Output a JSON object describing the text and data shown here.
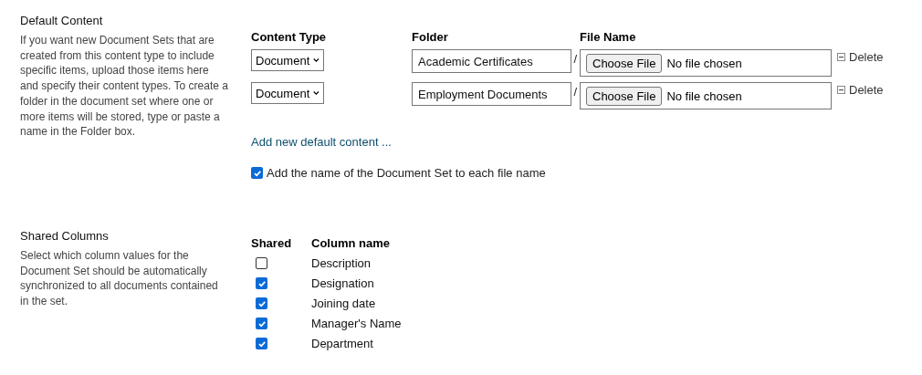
{
  "default_content": {
    "title": "Default Content",
    "description": "If you want new Document Sets that are created from this content type to include specific items, upload those items here and specify their content types. To create a folder in the document set where one or more items will be stored, type or paste a name in the Folder box.",
    "columns": [
      "Content Type",
      "Folder",
      "File Name"
    ],
    "rows": [
      {
        "content_type": "Document",
        "folder": "Academic Certificates",
        "separator": "/",
        "file_button": "Choose File",
        "file_status": "No file chosen",
        "delete": "Delete"
      },
      {
        "content_type": "Document",
        "folder": "Employment Documents",
        "separator": "/",
        "file_button": "Choose File",
        "file_status": "No file chosen",
        "delete": "Delete"
      }
    ],
    "add_link": "Add new default content ...",
    "add_name_option": {
      "label": "Add the name of the Document Set to each file name",
      "checked": true
    }
  },
  "shared_columns": {
    "title": "Shared Columns",
    "description": "Select which column values for the Document Set should be automatically synchronized to all documents contained in the set.",
    "headers": [
      "Shared",
      "Column name"
    ],
    "rows": [
      {
        "name": "Description",
        "checked": false
      },
      {
        "name": "Designation",
        "checked": true
      },
      {
        "name": "Joining date",
        "checked": true
      },
      {
        "name": "Manager's Name",
        "checked": true
      },
      {
        "name": "Department",
        "checked": true
      }
    ]
  }
}
